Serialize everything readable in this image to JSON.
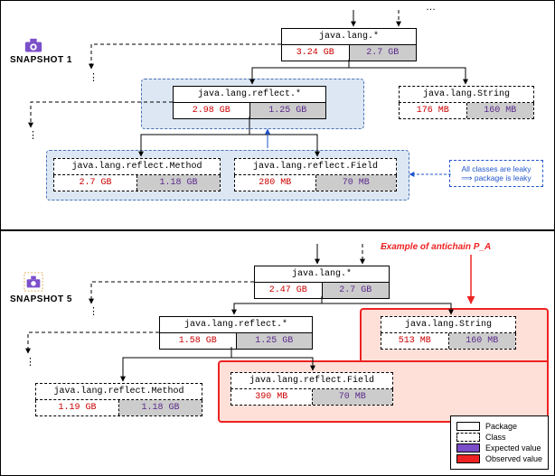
{
  "snapshot1": {
    "label": "SNAPSHOT 1",
    "nodes": {
      "root": {
        "title": "java.lang.*",
        "obs": "3.24 GB",
        "exp": "2.7 GB"
      },
      "reflect": {
        "title": "java.lang.reflect.*",
        "obs": "2.98 GB",
        "exp": "1.25 GB"
      },
      "string": {
        "title": "java.lang.String",
        "obs": "176 MB",
        "exp": "160 MB"
      },
      "method": {
        "title": "java.lang.reflect.Method",
        "obs": "2.7 GB",
        "exp": "1.18 GB"
      },
      "field": {
        "title": "java.lang.reflect.Field",
        "obs": "280 MB",
        "exp": "70 MB"
      }
    },
    "callout": "All classes are leaky ⟹ package is leaky"
  },
  "snapshot5": {
    "label": "SNAPSHOT 5",
    "nodes": {
      "root": {
        "title": "java.lang.*",
        "obs": "2.47 GB",
        "exp": "2.7 GB"
      },
      "reflect": {
        "title": "java.lang.reflect.*",
        "obs": "1.58 GB",
        "exp": "1.25 GB"
      },
      "string": {
        "title": "java.lang.String",
        "obs": "513 MB",
        "exp": "160 MB"
      },
      "method": {
        "title": "java.lang.reflect.Method",
        "obs": "1.19 GB",
        "exp": "1.18 GB"
      },
      "field": {
        "title": "java.lang.reflect.Field",
        "obs": "390 MB",
        "exp": "70 MB"
      }
    },
    "antichain_label": "Example of antichain P_A"
  },
  "legend": {
    "package": "Package",
    "class": "Class",
    "expected": "Expected value",
    "observed": "Observed value"
  },
  "ellipsis": "…"
}
